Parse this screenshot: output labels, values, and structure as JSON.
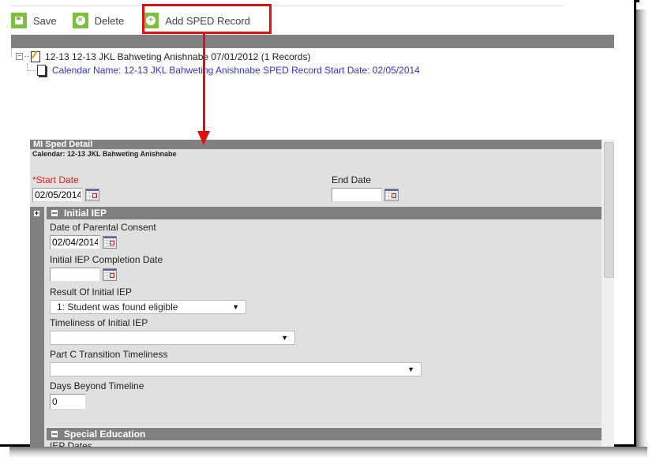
{
  "toolbar": {
    "save_label": "Save",
    "delete_label": "Delete",
    "add_label": "Add SPED Record"
  },
  "tree": {
    "parent_label": "12-13 12-13 JKL Bahweting Anishnabe 07/01/2012 (1 Records)",
    "child_label": "Calendar Name: 12-13 JKL Bahweting Anishnabe SPED Record Start Date: 02/05/2014"
  },
  "detail": {
    "title": "MI Sped Detail",
    "calendar": "Calendar: 12-13 JKL Bahweting Anishnabe",
    "start_date_required": "*",
    "start_date_label": "Start Date",
    "start_date_value": "02/05/2014",
    "end_date_label": "End Date",
    "end_date_value": ""
  },
  "initial_iep": {
    "section_title": "Initial IEP",
    "parental_consent_label": "Date of Parental Consent",
    "parental_consent_value": "02/04/2014",
    "completion_label": "Initial IEP Completion Date",
    "completion_value": "",
    "result_label": "Result Of Initial IEP",
    "result_value": "1: Student was found eligible",
    "timeliness_label": "Timeliness of Initial IEP",
    "timeliness_value": "",
    "partc_label": "Part C Transition Timeliness",
    "partc_value": "",
    "days_beyond_label": "Days Beyond Timeline",
    "days_beyond_value": "0"
  },
  "special_education": {
    "section_title": "Special Education",
    "cut_label": "IEP Dates"
  },
  "colors": {
    "accent_green": "#7dbf3f",
    "highlight_red": "#e01010",
    "header_gray": "#808080",
    "link_blue": "#3333cc"
  }
}
